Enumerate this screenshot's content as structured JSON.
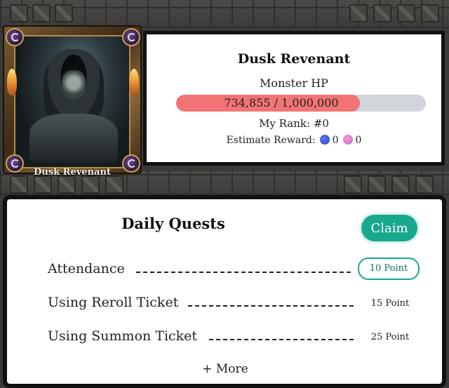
{
  "boss": {
    "card_name": "Dusk Revenant",
    "name": "Dusk Revenant",
    "hp_label": "Monster HP",
    "hp_text": "734,855 / 1,000,000",
    "hp_current": 734855,
    "hp_max": 1000000,
    "rank_text": "My Rank: #0",
    "reward_label": "Estimate Reward:",
    "reward_blue_value": "0",
    "reward_pink_value": "0"
  },
  "quests": {
    "title": "Daily Quests",
    "claim_label": "Claim",
    "items": [
      {
        "name": "Attendance",
        "points": "10 Point"
      },
      {
        "name": "Using Reroll Ticket",
        "points": "15 Point"
      },
      {
        "name": "Using Summon Ticket",
        "points": "25 Point"
      }
    ],
    "more_label": "+ More"
  },
  "colors": {
    "accent": "#17a88e",
    "hp_fill": "#f27373",
    "hp_track": "#d3d5dc"
  }
}
